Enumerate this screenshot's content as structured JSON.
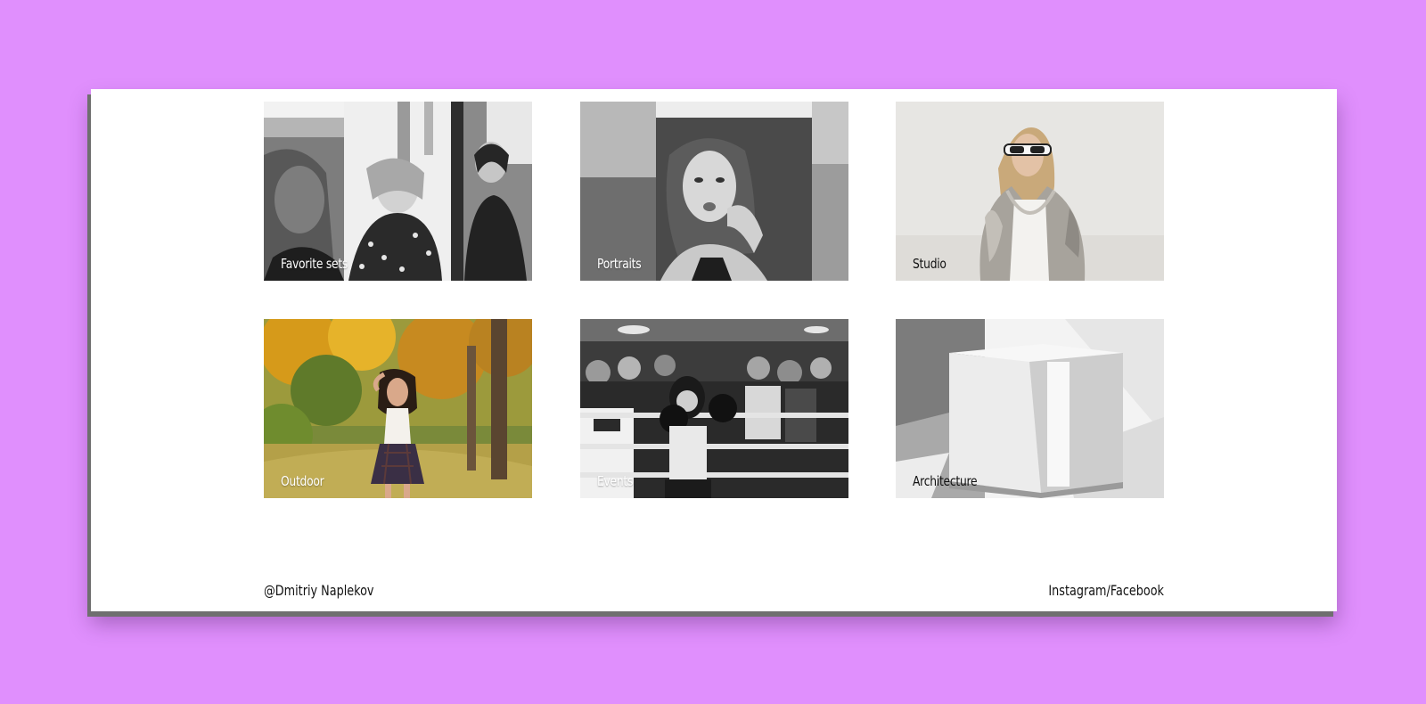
{
  "gallery": {
    "tiles": [
      {
        "label": "Favorite sets",
        "photo": "three-portraits-bw"
      },
      {
        "label": "Portraits",
        "photo": "portrait-mirror-bw"
      },
      {
        "label": "Studio",
        "photo": "studio-woman-fur-coat"
      },
      {
        "label": "Outdoor",
        "photo": "autumn-park-woman"
      },
      {
        "label": "Events",
        "photo": "boxing-ring-crowd-bw"
      },
      {
        "label": "Architecture",
        "photo": "white-cube-light-shadow"
      }
    ]
  },
  "footer": {
    "author": "@Dmitriy Naplekov",
    "social": "Instagram/Facebook"
  },
  "colors": {
    "background": "#e08ffd",
    "page": "#ffffff"
  }
}
